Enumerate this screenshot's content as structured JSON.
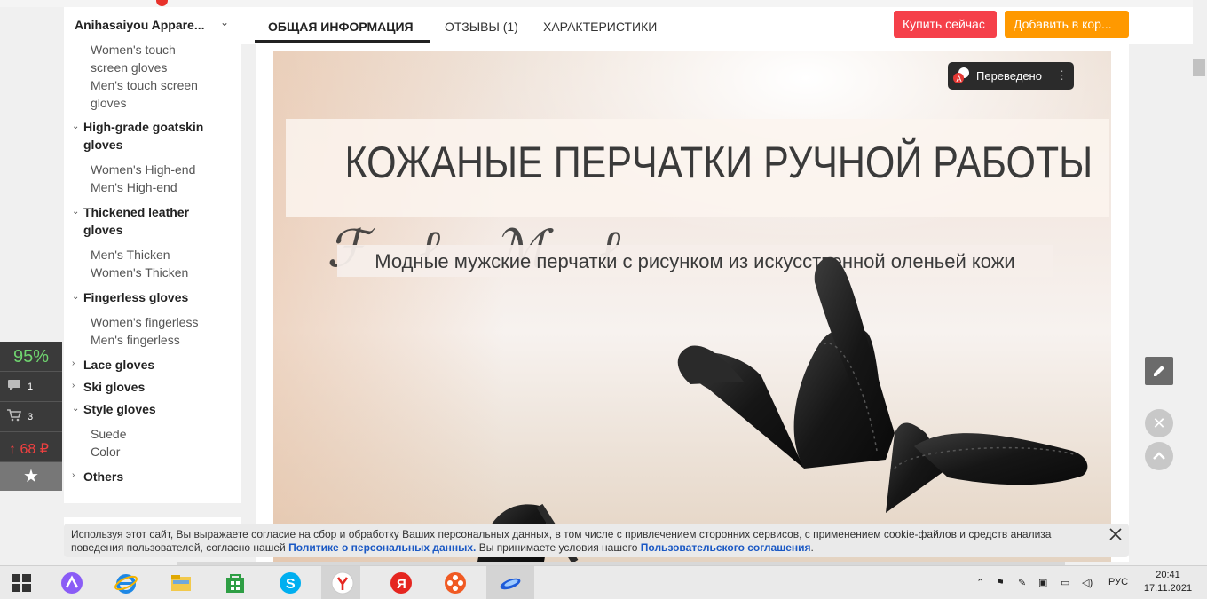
{
  "header": {
    "store_name": "Anihasaiyou Appare...",
    "tabs": [
      "ОБЩАЯ ИНФОРМАЦИЯ",
      "ОТЗЫВЫ (1)",
      "ХАРАКТЕРИСТИКИ"
    ],
    "buy_now": "Купить сейчас",
    "add_to_cart": "Добавить в кор..."
  },
  "sidebar": {
    "sub1": "Women's touch screen gloves",
    "sub2": "Men's touch screen gloves",
    "cat1": "High-grade goatskin gloves",
    "cat1_items": [
      "Women's High-end",
      "Men's High-end"
    ],
    "cat2": "Thickened leather gloves",
    "cat2_items": [
      "Men's Thicken",
      "Women's Thicken"
    ],
    "cat3": "Fingerless gloves",
    "cat3_items": [
      "Women's fingerless",
      "Men's fingerless"
    ],
    "cat4": "Lace gloves",
    "cat5": "Ski gloves",
    "cat6": "Style gloves",
    "cat6_items": [
      "Suede",
      "Color"
    ],
    "cat7": "Others"
  },
  "widget": {
    "percent": "95%",
    "comments": "1",
    "cart": "3",
    "price": "↑ 68 ₽"
  },
  "hero": {
    "title": "КОЖАНЫЕ ПЕРЧАТКИ РУЧНОЙ РАБОТЫ",
    "subtitle": "Модные мужские перчатки с рисунком из искусственной оленьей кожи",
    "translated_label": "Переведено"
  },
  "cookie": {
    "text1": "Используя этот сайт, Вы выражаете согласие на сбор и обработку Ваших персональных данных, в том числе с привлечением сторонних сервисов, с применением cookie-файлов и средств анализа поведения пользователей, согласно нашей ",
    "link1": "Политике о персональных данных.",
    "text2": " Вы принимаете условия нашего ",
    "link2": "Пользовательского соглашения",
    "text3": "."
  },
  "taskbar": {
    "lang": "РУС",
    "time": "20:41",
    "date": "17.11.2021"
  }
}
